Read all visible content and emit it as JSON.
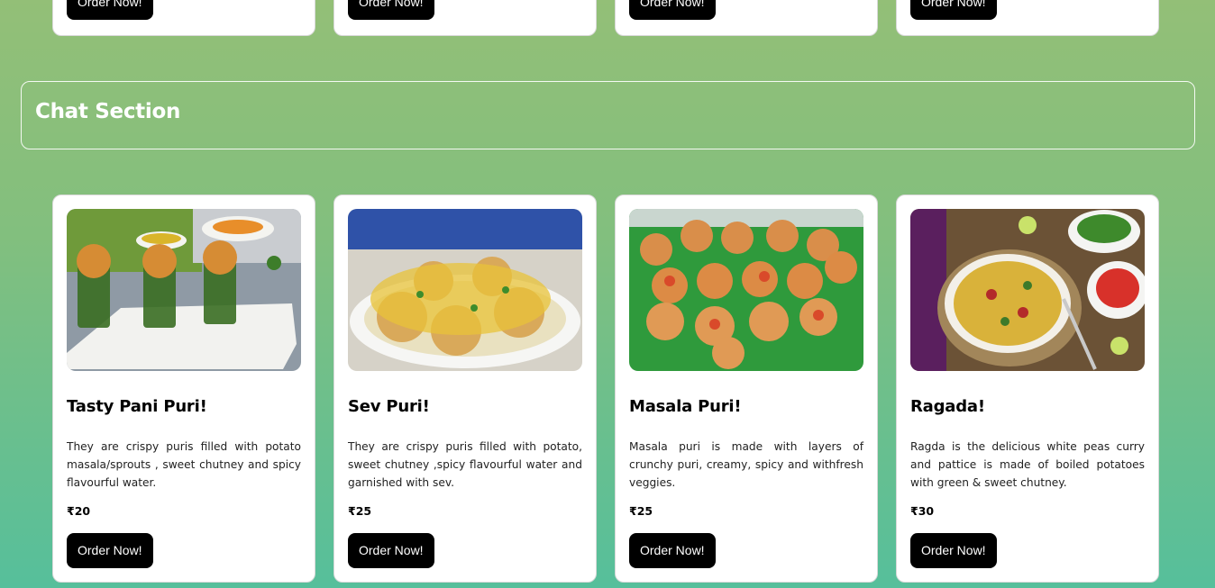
{
  "top_row": {
    "order_label": "Order Now!"
  },
  "chat_section": {
    "title": "Chat Section"
  },
  "cards": [
    {
      "title": "Tasty Pani Puri!",
      "description": "They are crispy puris filled with potato masala/sprouts , sweet chutney and spicy flavourful water.",
      "price": "₹20",
      "button": "Order Now!",
      "image": "pani-puri-image"
    },
    {
      "title": "Sev Puri!",
      "description": "They are crispy puris filled with potato, sweet chutney ,spicy flavourful water and garnished with sev.",
      "price": "₹25",
      "button": "Order Now!",
      "image": "sev-puri-image"
    },
    {
      "title": "Masala Puri!",
      "description": "Masala puri is made with layers of crunchy puri, creamy, spicy and withfresh veggies.",
      "price": "₹25",
      "button": "Order Now!",
      "image": "masala-puri-image"
    },
    {
      "title": "Ragada!",
      "description": "Ragda is the delicious white peas curry and pattice is made of boiled potatoes with green & sweet chutney.",
      "price": "₹30",
      "button": "Order Now!",
      "image": "ragada-image"
    }
  ],
  "colors": {
    "bg_top": "#93bf77",
    "bg_bottom": "#56bf9b",
    "button": "#000000",
    "card": "#ffffff"
  }
}
